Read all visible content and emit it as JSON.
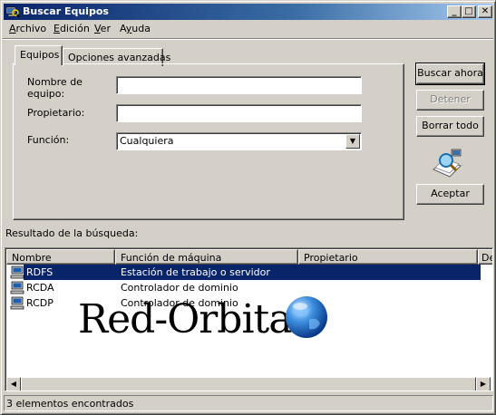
{
  "window": {
    "title": "Buscar Equipos"
  },
  "title_buttons": {
    "minimize": "_",
    "maximize": "□",
    "close": "✕"
  },
  "menu": [
    {
      "label": "Archivo",
      "mnemonic": "A",
      "rest": "rchivo"
    },
    {
      "label": "Edición",
      "mnemonic": "E",
      "rest": "dición"
    },
    {
      "label": "Ver",
      "mnemonic": "V",
      "rest": "er"
    },
    {
      "label": "Ayuda",
      "mnemonic": "y",
      "pre": "A",
      "rest": "uda"
    }
  ],
  "tabs": {
    "active": "Equipos",
    "inactive": "Opciones avanzadas"
  },
  "form": {
    "nombre_label": "Nombre de equipo:",
    "nombre_value": "",
    "propietario_label": "Propietario:",
    "propietario_value": "",
    "funcion_label": "Función:",
    "funcion_value": "Cualquiera"
  },
  "buttons": {
    "buscar": "Buscar ahora",
    "detener": "Detener",
    "borrar": "Borrar todo",
    "aceptar": "Aceptar"
  },
  "results": {
    "label": "Resultado de la búsqueda:",
    "columns": [
      "Nombre",
      "Función de máquina",
      "Propietario",
      "De"
    ],
    "rows": [
      {
        "nombre": "RDFS",
        "funcion": "Estación de trabajo o servidor",
        "selected": true
      },
      {
        "nombre": "RCDA",
        "funcion": "Controlador de dominio",
        "selected": false
      },
      {
        "nombre": "RCDP",
        "funcion": "Controlador de dominio",
        "selected": false
      }
    ]
  },
  "watermark": {
    "text": "Red-Orbita"
  },
  "status": "3 elementos encontrados",
  "colors": {
    "title_start": "#0a246a",
    "title_end": "#a6caf0",
    "selection": "#0a246a",
    "face": "#d4d0c8"
  }
}
